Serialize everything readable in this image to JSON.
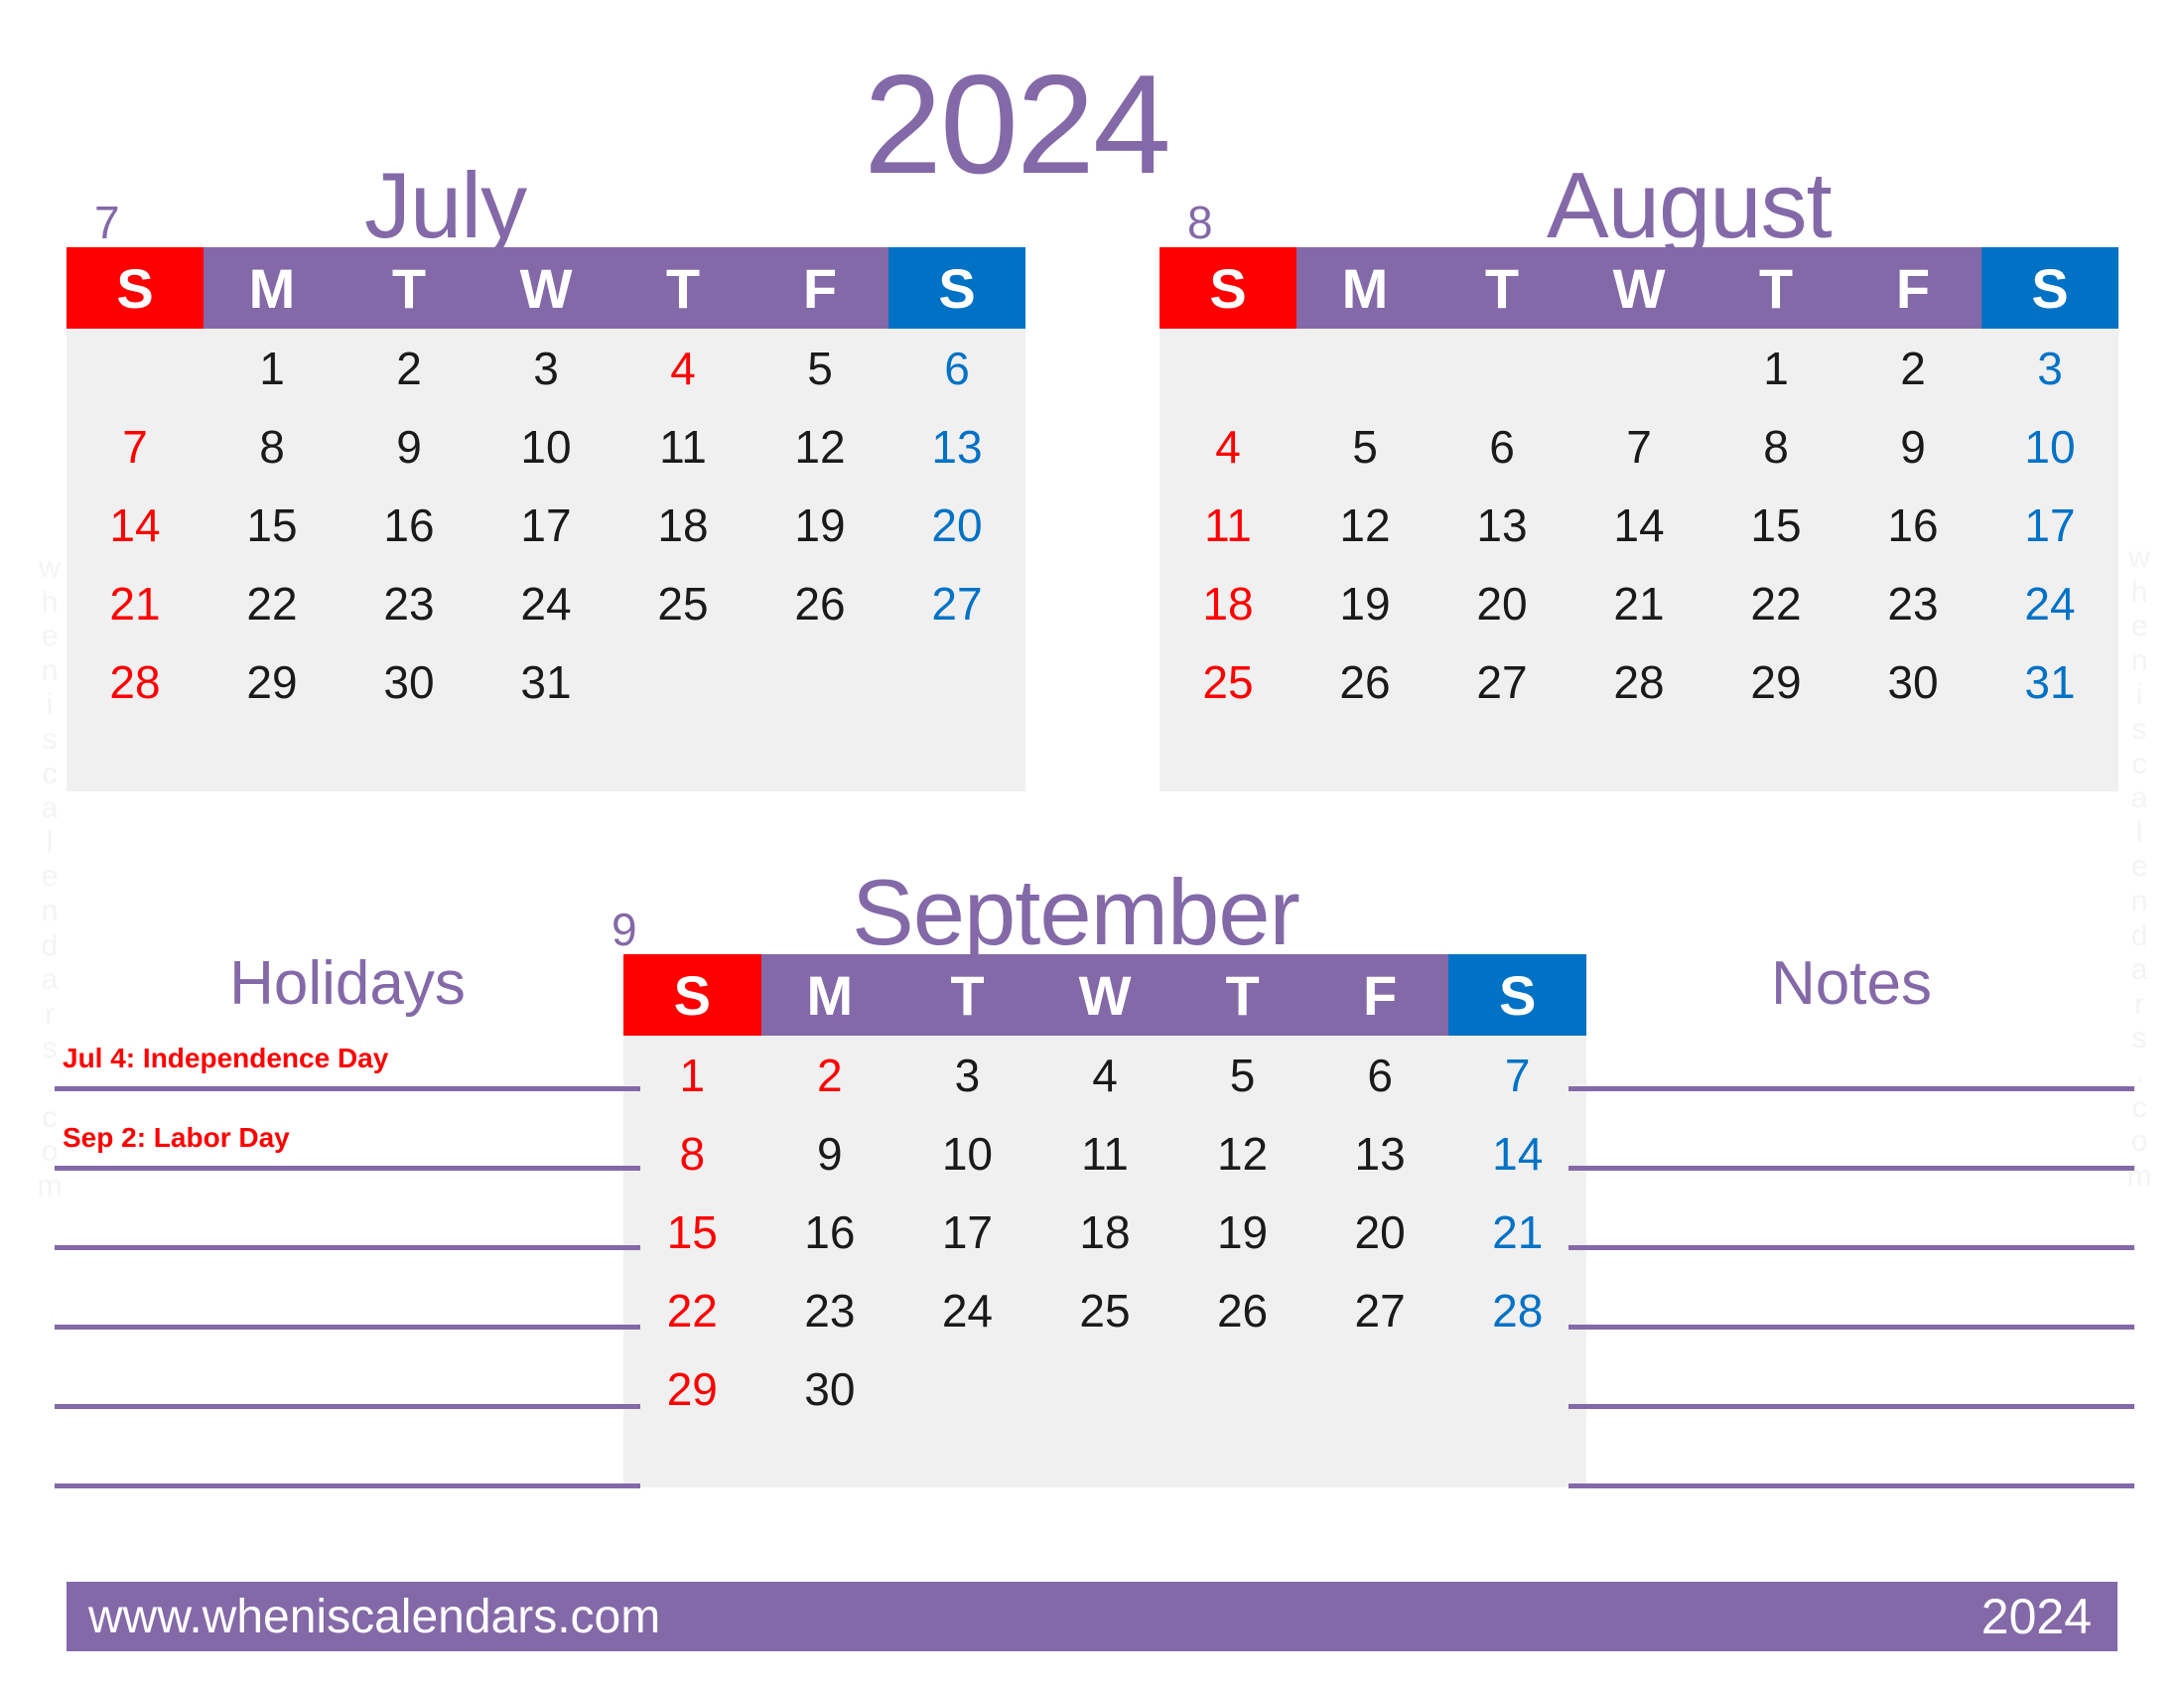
{
  "colors": {
    "purple": "#8469a8",
    "sunday_red": "#ff0000",
    "saturday_blue": "#0072c6",
    "grid_bg": "#f0f0f0",
    "holiday_red": "#ff0000"
  },
  "year_title": "2024",
  "watermark": "wheniscalendars.com",
  "dow_labels": [
    "S",
    "M",
    "T",
    "W",
    "T",
    "F",
    "S"
  ],
  "months": [
    {
      "number": "7",
      "name": "July",
      "weeks": [
        [
          "",
          "1",
          "2",
          "3",
          "4",
          "5",
          "6"
        ],
        [
          "7",
          "8",
          "9",
          "10",
          "11",
          "12",
          "13"
        ],
        [
          "14",
          "15",
          "16",
          "17",
          "18",
          "19",
          "20"
        ],
        [
          "21",
          "22",
          "23",
          "24",
          "25",
          "26",
          "27"
        ],
        [
          "28",
          "29",
          "30",
          "31",
          "",
          "",
          ""
        ]
      ],
      "holiday_days": [
        "4"
      ]
    },
    {
      "number": "8",
      "name": "August",
      "weeks": [
        [
          "",
          "",
          "",
          "",
          "1",
          "2",
          "3"
        ],
        [
          "4",
          "5",
          "6",
          "7",
          "8",
          "9",
          "10"
        ],
        [
          "11",
          "12",
          "13",
          "14",
          "15",
          "16",
          "17"
        ],
        [
          "18",
          "19",
          "20",
          "21",
          "22",
          "23",
          "24"
        ],
        [
          "25",
          "26",
          "27",
          "28",
          "29",
          "30",
          "31"
        ]
      ],
      "holiday_days": []
    },
    {
      "number": "9",
      "name": "September",
      "weeks": [
        [
          "1",
          "2",
          "3",
          "4",
          "5",
          "6",
          "7"
        ],
        [
          "8",
          "9",
          "10",
          "11",
          "12",
          "13",
          "14"
        ],
        [
          "15",
          "16",
          "17",
          "18",
          "19",
          "20",
          "21"
        ],
        [
          "22",
          "23",
          "24",
          "25",
          "26",
          "27",
          "28"
        ],
        [
          "29",
          "30",
          "",
          "",
          "",
          "",
          ""
        ]
      ],
      "holiday_days": [
        "2"
      ]
    }
  ],
  "holidays_panel": {
    "title": "Holidays",
    "entries": [
      "Jul 4: Independence Day",
      "Sep 2: Labor Day",
      "",
      "",
      "",
      ""
    ]
  },
  "notes_panel": {
    "title": "Notes",
    "entries": [
      "",
      "",
      "",
      "",
      "",
      ""
    ]
  },
  "footer": {
    "url": "www.wheniscalendars.com",
    "year": "2024"
  }
}
